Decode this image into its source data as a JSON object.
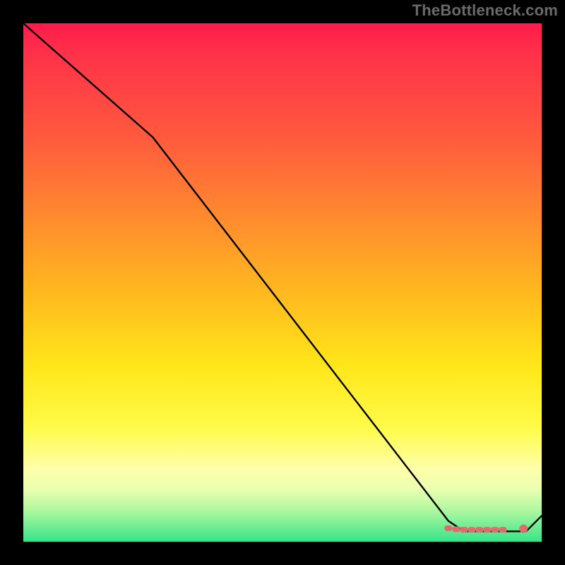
{
  "watermark": "TheBottleneck.com",
  "chart_data": {
    "type": "line",
    "title": "",
    "xlabel": "",
    "ylabel": "",
    "xlim": [
      0,
      100
    ],
    "ylim": [
      0,
      100
    ],
    "grid": false,
    "series": [
      {
        "name": "curve",
        "color": "#000000",
        "x": [
          0,
          25,
          82,
          85,
          92,
          97,
          100
        ],
        "y": [
          100,
          78,
          4,
          2,
          2,
          2,
          5
        ]
      }
    ],
    "markers": [
      {
        "name": "flat-segment-caterpillar",
        "color": "#e06a6c",
        "x": [
          82,
          83.5,
          85,
          86.5,
          88,
          89.5,
          91,
          92.5
        ],
        "y": [
          2.6,
          2.4,
          2.3,
          2.3,
          2.3,
          2.3,
          2.3,
          2.3
        ]
      },
      {
        "name": "end-dot",
        "color": "#e06a6c",
        "x": [
          96.5
        ],
        "y": [
          2.5
        ]
      }
    ],
    "gradient_stops": [
      {
        "pos": 0,
        "color": "#ff1a4b"
      },
      {
        "pos": 22,
        "color": "#ff5a3e"
      },
      {
        "pos": 52,
        "color": "#ffb91f"
      },
      {
        "pos": 78,
        "color": "#fffb4a"
      },
      {
        "pos": 100,
        "color": "#37e38a"
      }
    ]
  }
}
